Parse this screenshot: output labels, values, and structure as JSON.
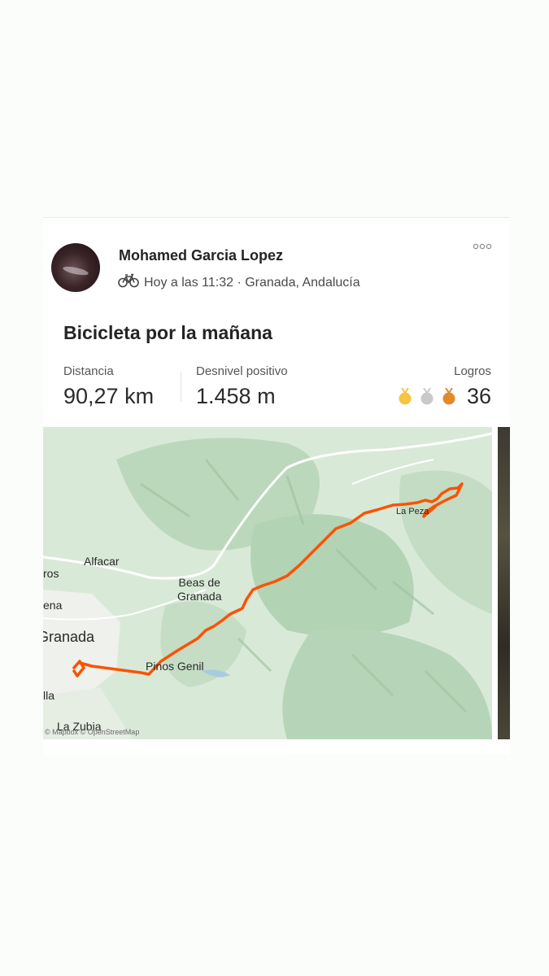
{
  "post": {
    "author": "Mohamed Garcia Lopez",
    "activity_icon": "bike-icon",
    "meta": "Hoy a las 11:32 · Granada, Andalucía",
    "more_icon": "more-horizontal-icon",
    "title": "Bicicleta por la mañana"
  },
  "stats": {
    "distance_label": "Distancia",
    "distance_value": "90,27 km",
    "elevation_label": "Desnivel positivo",
    "elevation_value": "1.458 m",
    "achievements_label": "Logros",
    "achievements_count": "36",
    "medals": [
      {
        "name": "gold",
        "color": "#f5c542"
      },
      {
        "name": "silver",
        "color": "#c9c9c9"
      },
      {
        "name": "bronze",
        "color": "#e08a2c"
      }
    ]
  },
  "map": {
    "places": {
      "alfacar": "Alfacar",
      "ros": "ros",
      "beas": "Beas de\nGranada",
      "ena": "ena",
      "granada": "Granada",
      "pinos": "Pinos Genil",
      "lla": "lla",
      "zubia": "La Zubia",
      "la_pesa": "La Peza"
    },
    "attribution": "© Mapbox © OpenStreetMap",
    "route_color": "#fc5200"
  },
  "colors": {
    "accent": "#fc5200",
    "background": "#fbfdfa"
  }
}
